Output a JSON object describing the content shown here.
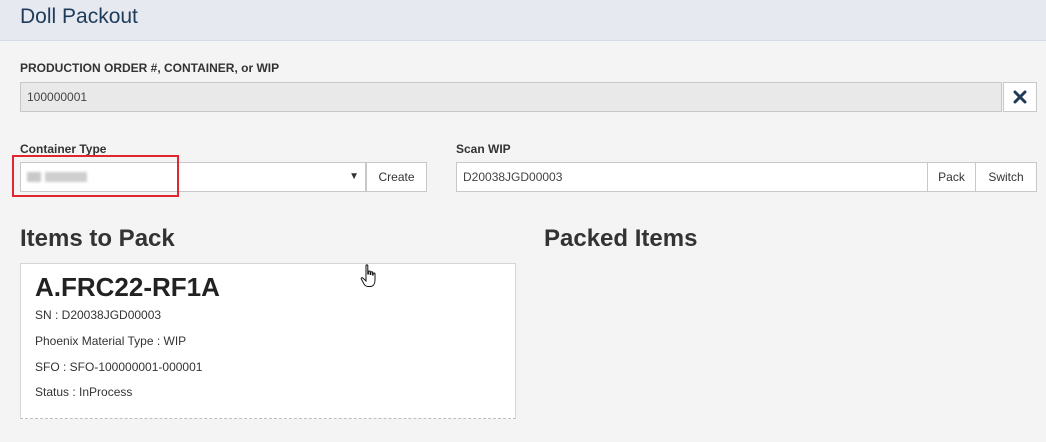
{
  "header": {
    "title": "Doll Packout"
  },
  "order": {
    "label": "PRODUCTION ORDER #, CONTAINER, or WIP",
    "value": "100000001",
    "clear_icon": "close-icon"
  },
  "container_type": {
    "label": "Container Type",
    "create_label": "Create",
    "caret": "▼"
  },
  "scan_wip": {
    "label": "Scan WIP",
    "value": "D20038JGD00003",
    "pack_label": "Pack",
    "switch_label": "Switch"
  },
  "items_to_pack": {
    "title": "Items to Pack",
    "item": {
      "part": "A.FRC22-RF1A",
      "sn": "SN : D20038JGD00003",
      "material_type": "Phoenix Material Type : WIP",
      "sfo": "SFO : SFO-100000001-000001",
      "status": "Status : InProcess"
    }
  },
  "packed_items": {
    "title": "Packed Items"
  },
  "colors": {
    "highlight": "#e0262e",
    "header_bg": "#e6eaf0",
    "title": "#1f3b5a"
  }
}
